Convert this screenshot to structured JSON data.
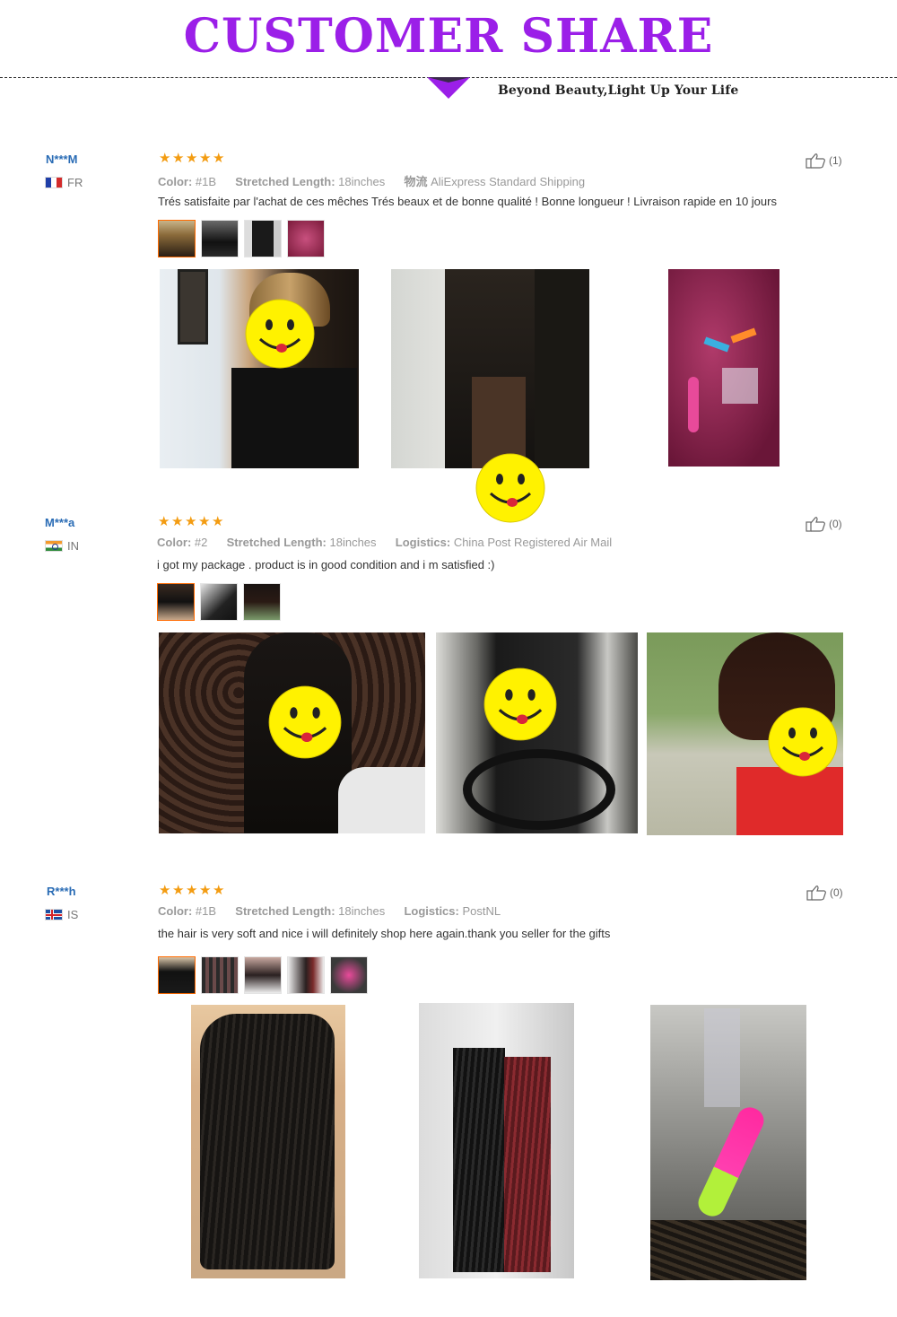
{
  "header": {
    "title": "CUSTOMER SHARE",
    "subtitle": "Beyond Beauty,Light Up Your Life",
    "accent_color": "#9b1fe8"
  },
  "reviews": [
    {
      "user": "N***M",
      "country": "FR",
      "rating": 5,
      "color_label": "Color:",
      "color_value": "#1B",
      "length_label": "Stretched Length:",
      "length_value": "18inches",
      "logistics_label": "物流",
      "logistics_value": "AliExpress Standard Shipping",
      "text": "Trés satisfaite par l'achat de ces mêches Trés beaux et de bonne qualité ! Bonne longueur ! Livraison rapide en 10 jours",
      "likes": "(1)",
      "thumbnail_count": 4
    },
    {
      "user": "M***a",
      "country": "IN",
      "rating": 5,
      "color_label": "Color:",
      "color_value": "#2",
      "length_label": "Stretched Length:",
      "length_value": "18inches",
      "logistics_label": "Logistics:",
      "logistics_value": "China Post Registered Air Mail",
      "text": "i got my package . product is in good condition and i m satisfied :)",
      "likes": "(0)",
      "thumbnail_count": 3
    },
    {
      "user": "R***h",
      "country": "IS",
      "rating": 5,
      "color_label": "Color:",
      "color_value": "#1B",
      "length_label": "Stretched Length:",
      "length_value": "18inches",
      "logistics_label": "Logistics:",
      "logistics_value": "PostNL",
      "text": "the hair is very soft and nice i will definitely shop here again.thank you seller for the gifts",
      "likes": "(0)",
      "thumbnail_count": 5
    }
  ],
  "icons": {
    "star": "star-icon",
    "like": "thumbs-up-icon",
    "smiley": "smiley-face-icon",
    "arrow": "triangle-down-icon"
  },
  "colors": {
    "star": "#f39c12",
    "active_thumb_border": "#ff6a00",
    "username": "#2a6cb5"
  }
}
